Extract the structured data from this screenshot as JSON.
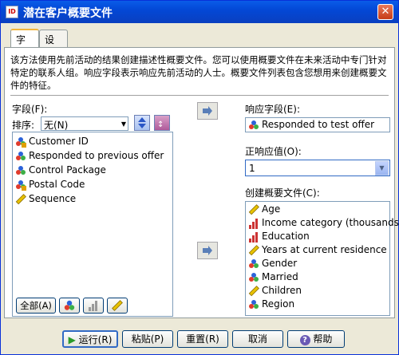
{
  "window": {
    "title": "潜在客户概要文件",
    "app_icon_text": "ID",
    "close_glyph": "✕"
  },
  "tabs": [
    {
      "label": "字段"
    },
    {
      "label": "设置"
    }
  ],
  "description": "该方法使用先前活动的结果创建描述性概要文件。您可以使用概要文件在未来活动中专门针对特定的联系人组。响应字段表示响应先前活动的人士。概要文件列表包含您想用来创建概要文件的特征。",
  "fields": {
    "label": "字段(F):",
    "sort_label": "排序:",
    "sort_value": "无(N)",
    "items": [
      {
        "label": "Customer ID",
        "icon": "nominal-lock-icon"
      },
      {
        "label": "Responded to previous offer",
        "icon": "nominal-icon"
      },
      {
        "label": "Control Package",
        "icon": "nominal-icon"
      },
      {
        "label": "Postal Code",
        "icon": "nominal-lock-icon"
      },
      {
        "label": "Sequence",
        "icon": "scale-ruler-icon"
      }
    ],
    "all_button": "全部(A)"
  },
  "response_field": {
    "label": "响应字段(E):",
    "value": "Responded to test offer"
  },
  "positive_value": {
    "label": "正响应值(O):",
    "value": "1"
  },
  "profile": {
    "label": "创建概要文件(C):",
    "items": [
      {
        "label": "Age",
        "icon": "scale-ruler-icon"
      },
      {
        "label": "Income category (thousands)",
        "icon": "ordinal-bars-icon"
      },
      {
        "label": "Education",
        "icon": "ordinal-bars-icon"
      },
      {
        "label": "Years at current residence",
        "icon": "scale-ruler-icon"
      },
      {
        "label": "Gender",
        "icon": "nominal-icon"
      },
      {
        "label": "Married",
        "icon": "nominal-icon"
      },
      {
        "label": "Children",
        "icon": "scale-ruler-icon"
      },
      {
        "label": "Region",
        "icon": "nominal-icon"
      }
    ]
  },
  "buttons": {
    "run": "运行(R)",
    "paste": "粘贴(P)",
    "reset": "重置(R)",
    "cancel": "取消",
    "help": "帮助"
  },
  "colors": {
    "title_bar": "#0a5ce8",
    "tab_highlight": "#f2b53c",
    "selected_border": "#316ac5"
  }
}
